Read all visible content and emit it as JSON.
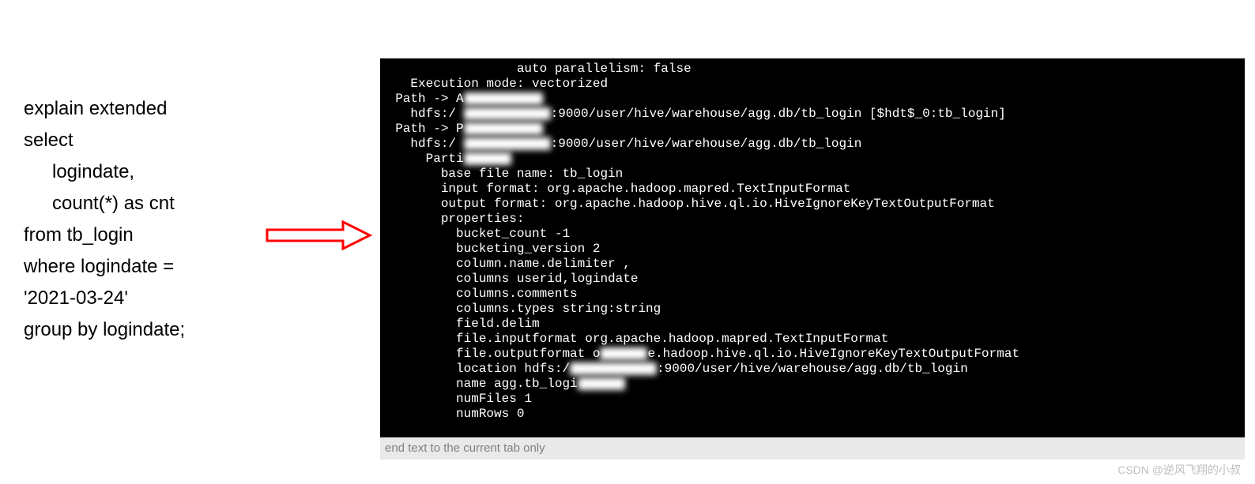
{
  "sql": {
    "l1": "explain extended",
    "l2": "select",
    "l3": "logindate,",
    "l4": "count(*) as cnt",
    "l5": "from tb_login",
    "l6": "where logindate =",
    "l7": "'2021-03-24'",
    "l8": "group by logindate;"
  },
  "term": {
    "l01a": "                  auto parallelism: false",
    "l02": "    Execution mode: vectorized",
    "l03a": "  Path -> A",
    "l04a": "    hdfs:/",
    "l04b": ":9000/user/hive/warehouse/agg.db/tb_login [$hdt$_0:tb_login]",
    "l05a": "  Path -> P",
    "l06a": "    hdfs:/",
    "l06b": ":9000/user/hive/warehouse/agg.db/tb_login",
    "l07": "      Parti",
    "l08": "        base file name: tb_login",
    "l09": "        input format: org.apache.hadoop.mapred.TextInputFormat",
    "l10": "        output format: org.apache.hadoop.hive.ql.io.HiveIgnoreKeyTextOutputFormat",
    "l11": "        properties:",
    "l12": "          bucket_count -1",
    "l13": "          bucketing_version 2",
    "l14": "          column.name.delimiter ,",
    "l15": "          columns userid,logindate",
    "l16": "          columns.comments",
    "l17": "          columns.types string:string",
    "l18": "          field.delim",
    "l19": "          file.inputformat org.apache.hadoop.mapred.TextInputFormat",
    "l20a": "          file.outputformat o",
    "l20b": "e.hadoop.hive.ql.io.HiveIgnoreKeyTextOutputFormat",
    "l21a": "          location hdfs:/",
    "l21b": ":9000/user/hive/warehouse/agg.db/tb_login",
    "l22": "          name agg.tb_logi",
    "l23": "          numFiles 1",
    "l24": "          numRows 0"
  },
  "statusbar": "end text to the current tab only",
  "watermark": "CSDN @逆风飞翔的小叔"
}
